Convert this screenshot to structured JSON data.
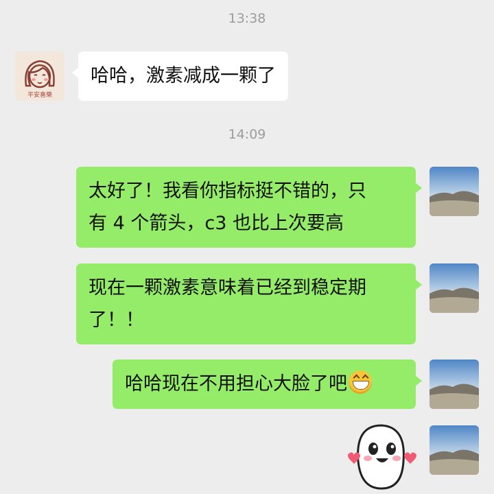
{
  "chat": {
    "messages": [
      {
        "type": "time",
        "text": "13:38"
      },
      {
        "type": "msg",
        "side": "left",
        "lines": [
          "哈哈，激素减成一颗了"
        ]
      },
      {
        "type": "time",
        "text": "14:09"
      },
      {
        "type": "msg",
        "side": "right",
        "lines": [
          "太好了！我看你指标挺不错的，只",
          "有 4 个箭头，c3 也比上次要高"
        ]
      },
      {
        "type": "msg",
        "side": "right",
        "lines": [
          "现在一颗激素意味着已经到稳定期",
          "了！！"
        ]
      },
      {
        "type": "msg",
        "side": "right",
        "lines": [
          "哈哈现在不用担心大脸了吧"
        ],
        "emoji": "grinning-face"
      },
      {
        "type": "sticker",
        "side": "right",
        "sticker": "cute-face-hearts-sticker"
      }
    ]
  },
  "contact": {
    "avatar_text": "平安喜樂"
  },
  "colors": {
    "background": "#ededed",
    "bubble_self": "#95ec69",
    "bubble_other": "#ffffff",
    "timestamp": "#9c9c9c"
  }
}
